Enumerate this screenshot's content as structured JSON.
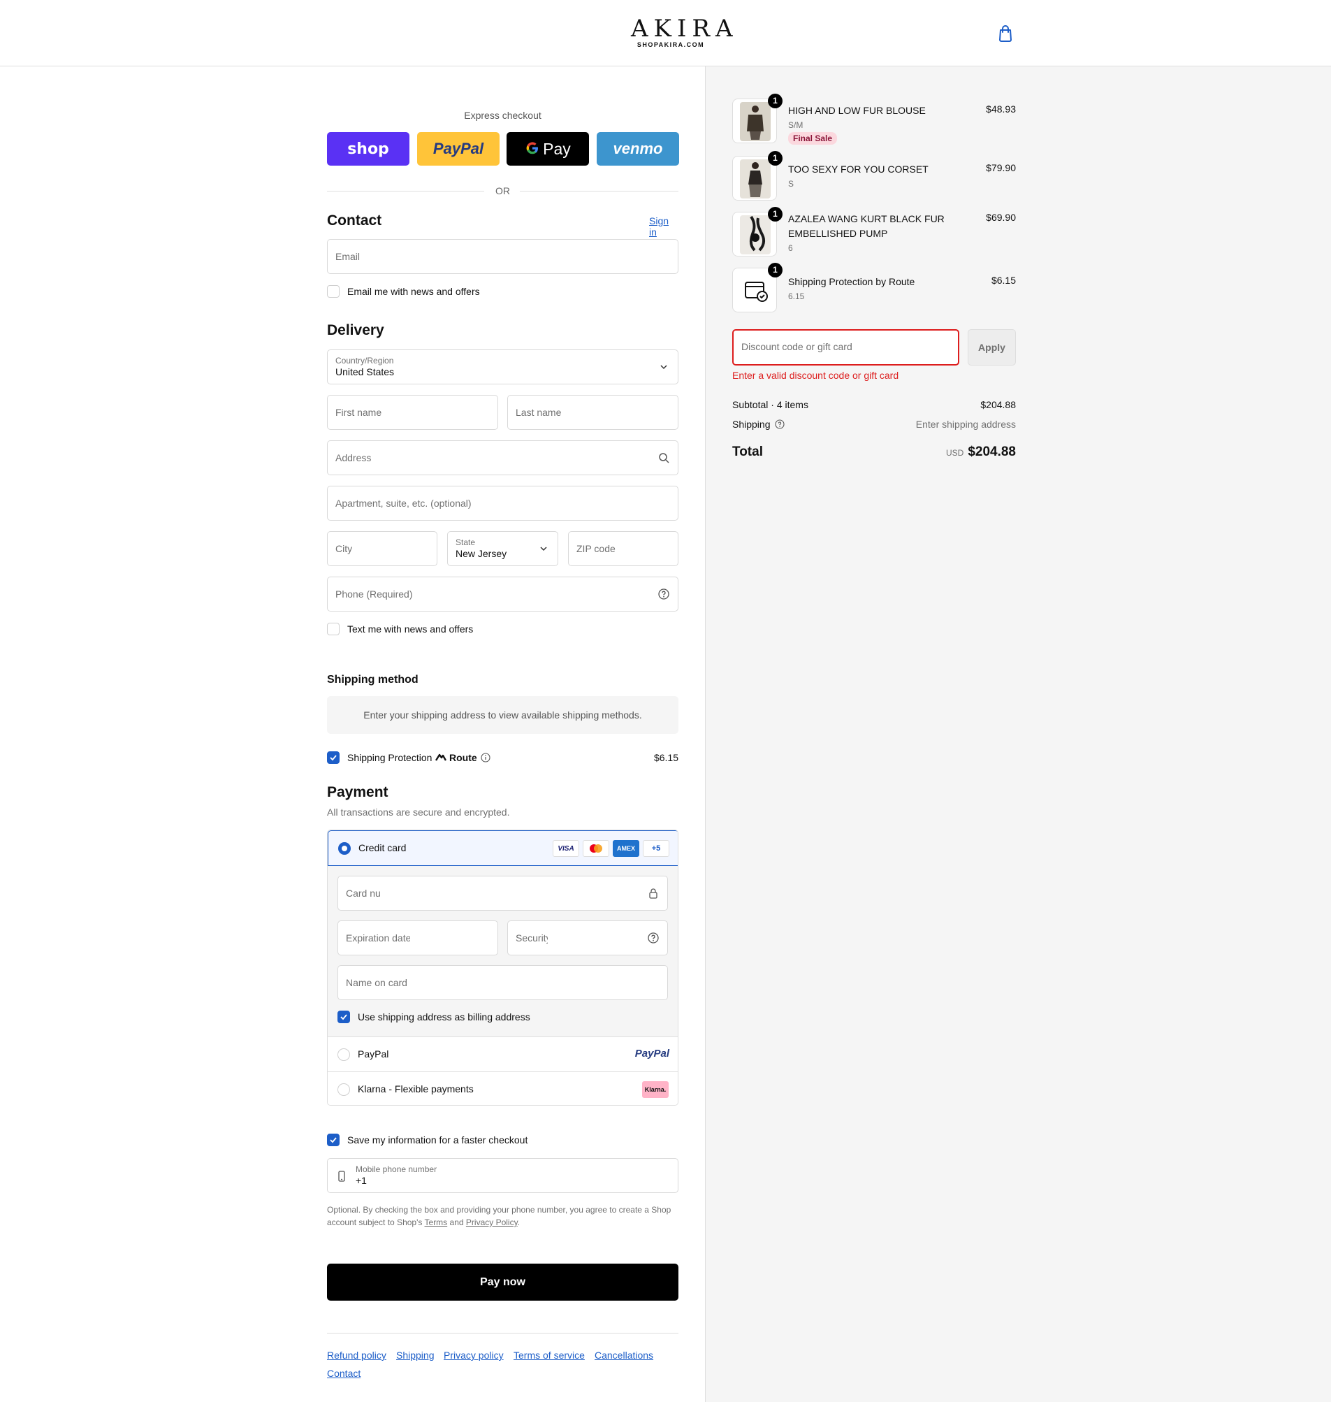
{
  "brand": {
    "name": "AKIRA",
    "domain": "SHOPAKIRA.COM"
  },
  "express": {
    "title": "Express checkout",
    "buttons": [
      {
        "label": "shop",
        "color": "#5a31f4",
        "text_color": "#ffffff"
      },
      {
        "label": "PayPal",
        "color": "#ffc439",
        "text_color": "#253b80"
      },
      {
        "label": "Pay",
        "color": "#000000",
        "text_color": "#ffffff"
      },
      {
        "label": "venmo",
        "color": "#3d95ce",
        "text_color": "#ffffff"
      }
    ],
    "or": "OR"
  },
  "contact": {
    "heading": "Contact",
    "sign_in": "Sign in",
    "email_placeholder": "Email",
    "news_label": "Email me with news and offers"
  },
  "delivery": {
    "heading": "Delivery",
    "country_label": "Country/Region",
    "country_value": "United States",
    "first_name": "First name",
    "last_name": "Last name",
    "address": "Address",
    "apartment": "Apartment, suite, etc. (optional)",
    "city": "City",
    "state_label": "State",
    "state_value": "New Jersey",
    "zip": "ZIP code",
    "phone": "Phone (Required)",
    "text_label": "Text me with news and offers"
  },
  "shipping_method": {
    "heading": "Shipping method",
    "notice": "Enter your shipping address to view available shipping methods.",
    "protection_label": "Shipping Protection",
    "route_brand": "Route",
    "protection_price": "$6.15"
  },
  "payment": {
    "heading": "Payment",
    "subtitle": "All transactions are secure and encrypted.",
    "credit_card_label": "Credit card",
    "card_brands": [
      "VISA",
      "",
      "AMEX",
      "+5"
    ],
    "card_number": "Card nu",
    "expiration": "Expiration date",
    "security": "Security",
    "name_on_card": "Name on card",
    "billing_label": "Use shipping address as billing address",
    "paypal_label": "PayPal",
    "paypal_logo": "PayPal",
    "klarna_label": "Klarna - Flexible payments",
    "klarna_logo": "Klarna."
  },
  "save_info": {
    "label": "Save my information for a faster checkout",
    "mobile_label": "Mobile phone number",
    "mobile_value": "+1",
    "legal_1": "Optional. By checking the box and providing your phone number, you agree to create a Shop",
    "legal_2": "account subject to Shop's",
    "terms": "Terms",
    "and": "and",
    "privacy": "Privacy Policy",
    "period": "."
  },
  "pay_now": "Pay now",
  "footer": {
    "links": [
      "Refund policy",
      "Shipping",
      "Privacy policy",
      "Terms of service",
      "Cancellations",
      "Contact"
    ]
  },
  "order": {
    "items": [
      {
        "name": "HIGH AND LOW FUR BLOUSE",
        "variant": "S/M",
        "price": "$48.93",
        "qty": "1",
        "badge": "Final Sale"
      },
      {
        "name": "TOO SEXY FOR YOU CORSET",
        "variant": "S",
        "price": "$79.90",
        "qty": "1"
      },
      {
        "name_line1": "AZALEA WANG KURT BLACK FUR",
        "name_line2": "EMBELLISHED PUMP",
        "variant": "6",
        "price": "$69.90",
        "qty": "1"
      },
      {
        "name": "Shipping Protection by Route",
        "variant": "6.15",
        "price": "$6.15",
        "qty": "1"
      }
    ],
    "discount_placeholder": "Discount code or gift card",
    "apply": "Apply",
    "discount_error": "Enter a valid discount code or gift card",
    "subtotal_label": "Subtotal · 4 items",
    "subtotal_value": "$204.88",
    "shipping_label": "Shipping",
    "shipping_value": "Enter shipping address",
    "total_label": "Total",
    "currency": "USD",
    "total_value": "$204.88"
  },
  "colors": {
    "accent": "#1d5ec8",
    "error": "#dd1d1d",
    "sidebar": "#f5f5f5"
  }
}
